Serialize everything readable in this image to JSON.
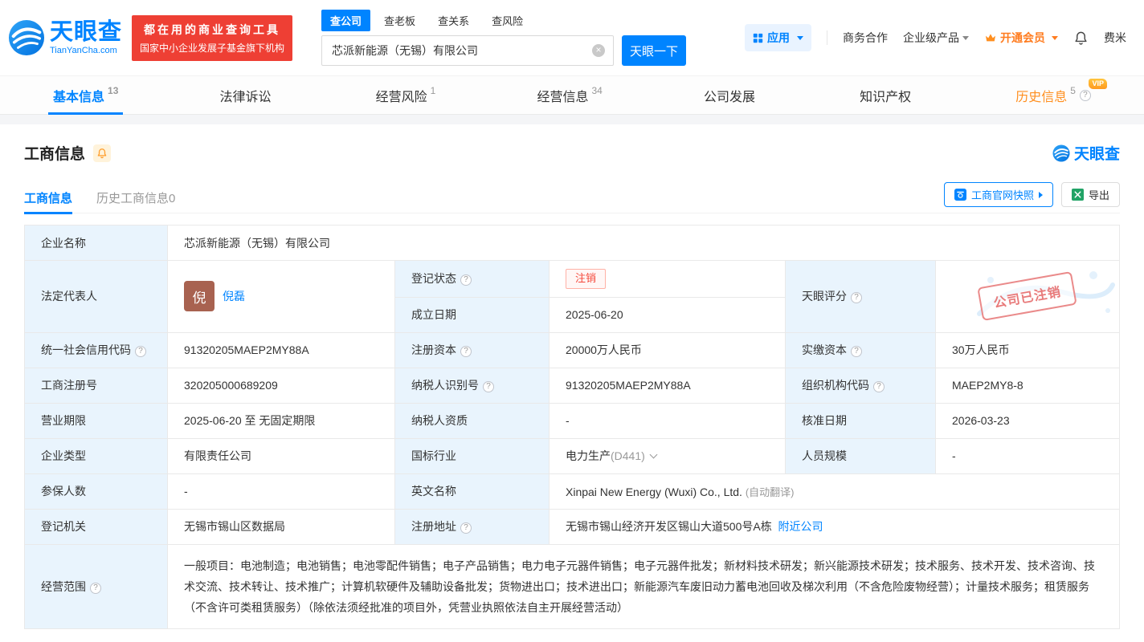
{
  "brand": {
    "name": "天眼查",
    "domain": "TianYanCha.com",
    "slogan1": "都在用的商业查询工具",
    "slogan2": "国家中小企业发展子基金旗下机构",
    "colors": {
      "primary_blue": "#0084ff",
      "banner_red": "#ee3f34",
      "vip_orange": "#ff8f1f",
      "status_red": "#f5483b",
      "label_cell_blue": "#e9f4fd"
    }
  },
  "search": {
    "tabs": [
      "查公司",
      "查老板",
      "查关系",
      "查风险"
    ],
    "value": "芯派新能源（无锡）有限公司",
    "submit": "天眼一下"
  },
  "topnav": {
    "apps": "应用",
    "biz": "商务合作",
    "enterprise": "企业级产品",
    "vip": "开通会员",
    "user": "费米"
  },
  "tabs": [
    {
      "label": "基本信息",
      "count": "13"
    },
    {
      "label": "法律诉讼",
      "count": ""
    },
    {
      "label": "经营风险",
      "count": "1"
    },
    {
      "label": "经营信息",
      "count": "34"
    },
    {
      "label": "公司发展",
      "count": ""
    },
    {
      "label": "知识产权",
      "count": ""
    },
    {
      "label": "历史信息",
      "count": "5",
      "badge": "VIP"
    }
  ],
  "section": {
    "title": "工商信息",
    "watermark": "天眼查",
    "subtabs": [
      {
        "label": "工商信息"
      },
      {
        "label": "历史工商信息0"
      }
    ],
    "snapshot_button": "工商官网快照",
    "export_button": "导出"
  },
  "info": {
    "company_name": {
      "label": "企业名称",
      "value": "芯派新能源（无锡）有限公司"
    },
    "legal_rep": {
      "label": "法定代表人",
      "avatar": "倪",
      "name": "倪磊"
    },
    "reg_status": {
      "label": "登记状态",
      "value": "注销"
    },
    "establish_date": {
      "label": "成立日期",
      "value": "2025-06-20"
    },
    "score": {
      "label": "天眼评分",
      "stamp": "公司已注销"
    },
    "credit_code": {
      "label": "统一社会信用代码",
      "value": "91320205MAEP2MY88A"
    },
    "reg_capital": {
      "label": "注册资本",
      "value": "20000万人民币"
    },
    "paid_capital": {
      "label": "实缴资本",
      "value": "30万人民币"
    },
    "reg_no": {
      "label": "工商注册号",
      "value": "320205000689209"
    },
    "taxpayer_no": {
      "label": "纳税人识别号",
      "value": "91320205MAEP2MY88A"
    },
    "org_code": {
      "label": "组织机构代码",
      "value": "MAEP2MY8-8"
    },
    "term": {
      "label": "营业期限",
      "value": "2025-06-20 至 无固定期限"
    },
    "taxpayer_quality": {
      "label": "纳税人资质",
      "value": "-"
    },
    "approve_date": {
      "label": "核准日期",
      "value": "2026-03-23"
    },
    "company_type": {
      "label": "企业类型",
      "value": "有限责任公司"
    },
    "industry": {
      "label": "国标行业",
      "value": "电力生产",
      "code": "(D441)"
    },
    "staff": {
      "label": "人员规模",
      "value": "-"
    },
    "insured": {
      "label": "参保人数",
      "value": "-"
    },
    "en_name": {
      "label": "英文名称",
      "value": "Xinpai New Energy (Wuxi) Co., Ltd.",
      "note": "(自动翻译)"
    },
    "authority": {
      "label": "登记机关",
      "value": "无锡市锡山区数据局"
    },
    "address": {
      "label": "注册地址",
      "value": "无锡市锡山经济开发区锡山大道500号A栋",
      "nearby": "附近公司"
    },
    "scope": {
      "label": "经营范围",
      "value": "一般项目：电池制造；电池销售；电池零配件销售；电子产品销售；电力电子元器件销售；电子元器件批发；新材料技术研发；新兴能源技术研发；技术服务、技术开发、技术咨询、技术交流、技术转让、技术推广；计算机软硬件及辅助设备批发；货物进出口；技术进出口；新能源汽车废旧动力蓄电池回收及梯次利用（不含危险废物经营）；计量技术服务；租赁服务（不含许可类租赁服务）（除依法须经批准的项目外，凭营业执照依法自主开展经营活动）"
    }
  }
}
